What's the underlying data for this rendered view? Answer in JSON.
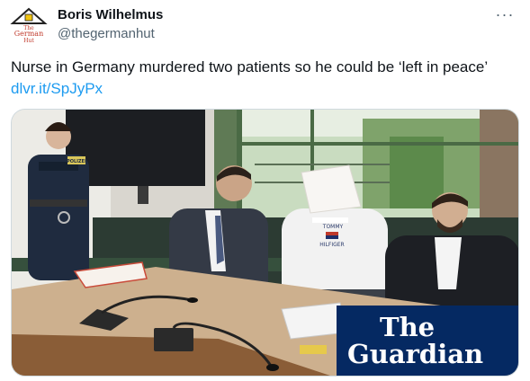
{
  "author": {
    "name": "Boris Wilhelmus",
    "handle": "@thegermanhut",
    "avatar_text_top": "The",
    "avatar_text_mid": "German",
    "avatar_text_bot": "Hut"
  },
  "more_icon": "more-dots-icon",
  "more_label": "···",
  "tweet": {
    "text": "Nurse in Germany murdered two patients so he could be ‘left in peace’",
    "link": "dlvr.it/SpJyPx"
  },
  "media": {
    "watermark_line1": "The",
    "watermark_line2": "Guardian",
    "sweater_text_a": "TOMMY",
    "sweater_text_b": "HILFIGER",
    "police_patch": "POLIZEI"
  },
  "colors": {
    "link": "#1d9bf0",
    "guardian_bg": "#052962",
    "secondary_text": "#536471"
  }
}
